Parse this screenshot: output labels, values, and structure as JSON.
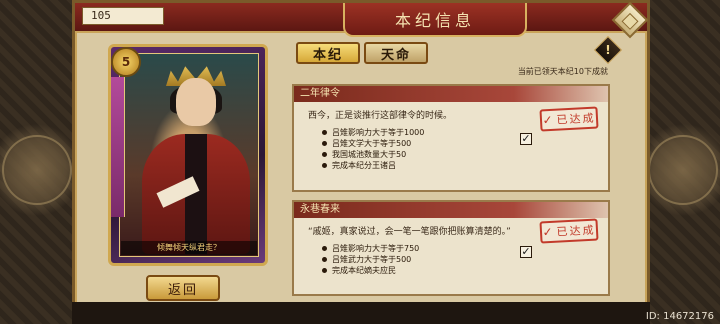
{
  "header": {
    "title": "本纪信息",
    "player_level": "105"
  },
  "card": {
    "rank": "5",
    "caption": "倾舞倾天纵君走？"
  },
  "tabs": [
    {
      "label": "本纪",
      "active": true
    },
    {
      "label": "天命",
      "active": false
    }
  ],
  "completed_count": "当前已领天本纪10下成就",
  "quests": [
    {
      "title": "二年律令",
      "description": "西今，正是谈推行这部律令的时候。",
      "requirements": [
        {
          "text": "吕雉影响力大于等于1000",
          "checked": true
        },
        {
          "text": "吕雉文学大于等于500",
          "checked": false
        },
        {
          "text": "我国城池数量大于50",
          "checked": false
        },
        {
          "text": "完成本纪分王诸吕",
          "checked": false
        }
      ],
      "stamp": "已达成"
    },
    {
      "title": "永巷春来",
      "description": "“戚姬，真家说过，会一笔一笔跟你把账算清楚的。”",
      "requirements": [
        {
          "text": "吕雉影响力大于等于750",
          "checked": true
        },
        {
          "text": "吕雉武力大于等于500",
          "checked": false
        },
        {
          "text": "完成本纪嫡夫应民",
          "checked": false
        }
      ],
      "stamp": "已达成"
    }
  ],
  "buttons": {
    "back": "返回"
  },
  "footer": {
    "id_text": "ID: 14672176"
  },
  "icons": {
    "info": "exclamation-diamond-icon",
    "corner": "diamond-ornament-icon",
    "check": "check-mark"
  },
  "colors": {
    "title_bar": "#8b2a1f",
    "stamp": "#c23a2a",
    "tab_active": "#f6dc7a",
    "card_frame": "#d0a850"
  }
}
